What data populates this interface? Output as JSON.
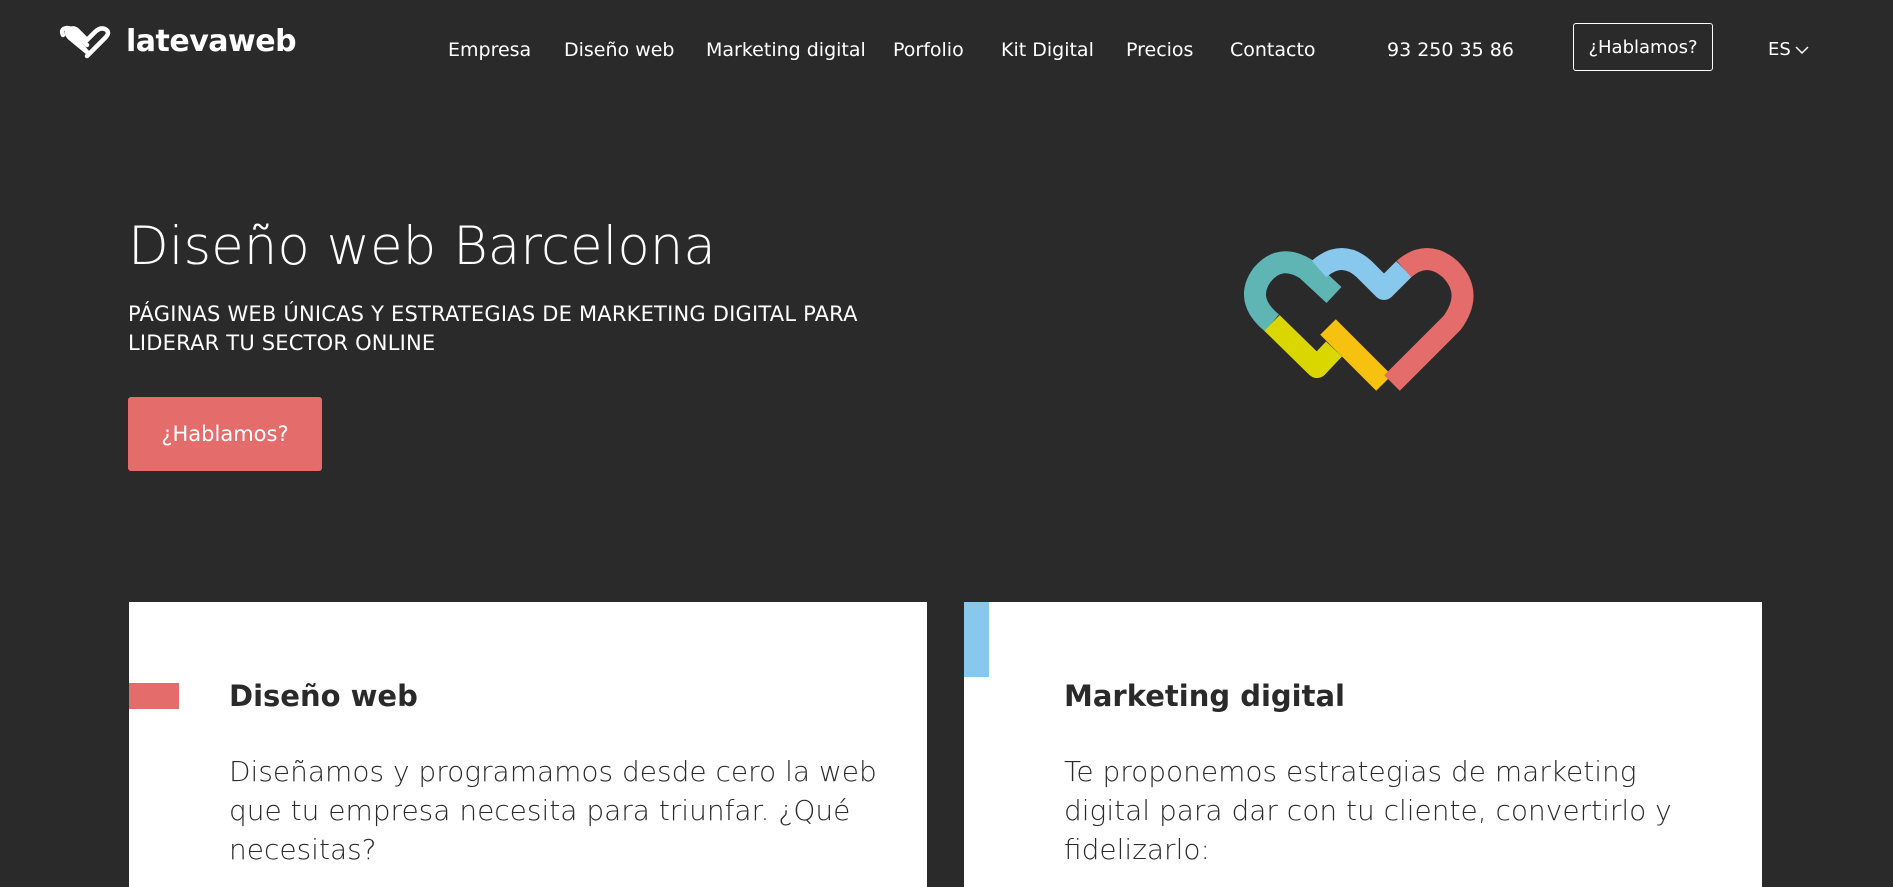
{
  "header": {
    "logo_text": "latevaweb",
    "nav": [
      {
        "label": "Empresa"
      },
      {
        "label": "Diseño web"
      },
      {
        "label": "Marketing digital"
      },
      {
        "label": "Porfolio"
      },
      {
        "label": "Kit Digital"
      },
      {
        "label": "Precios"
      },
      {
        "label": "Contacto"
      }
    ],
    "phone": "93 250 35 86",
    "cta_label": "¿Hablamos?",
    "language": "ES",
    "language_icon": "chevron-down-icon"
  },
  "hero": {
    "title": "Diseño web Barcelona",
    "subtitle": "PÁGINAS WEB ÚNICAS Y ESTRATEGIAS DE MARKETING DIGITAL PARA LIDERAR TU SECTOR ONLINE",
    "cta_label": "¿Hablamos?",
    "logo_icon": "double-heart-logo-icon"
  },
  "cards": [
    {
      "title": "Diseño web",
      "text": "Diseñamos y programamos desde cero la web que tu empresa necesita para triunfar. ¿Qué necesitas?"
    },
    {
      "title": "Marketing digital",
      "text": "Te proponemos estrategias de marketing digital para dar con tu cliente, convertirlo y fidelizarlo:"
    }
  ],
  "colors": {
    "background": "#2a2a2a",
    "accent_red": "#e46c6b",
    "accent_blue": "#88c8ec",
    "logo_teal": "#5fb4b4",
    "logo_yellow": "#d9d600",
    "logo_orange": "#f6c10f",
    "card_background": "#ffffff",
    "text_dark": "#2a2a2a"
  }
}
